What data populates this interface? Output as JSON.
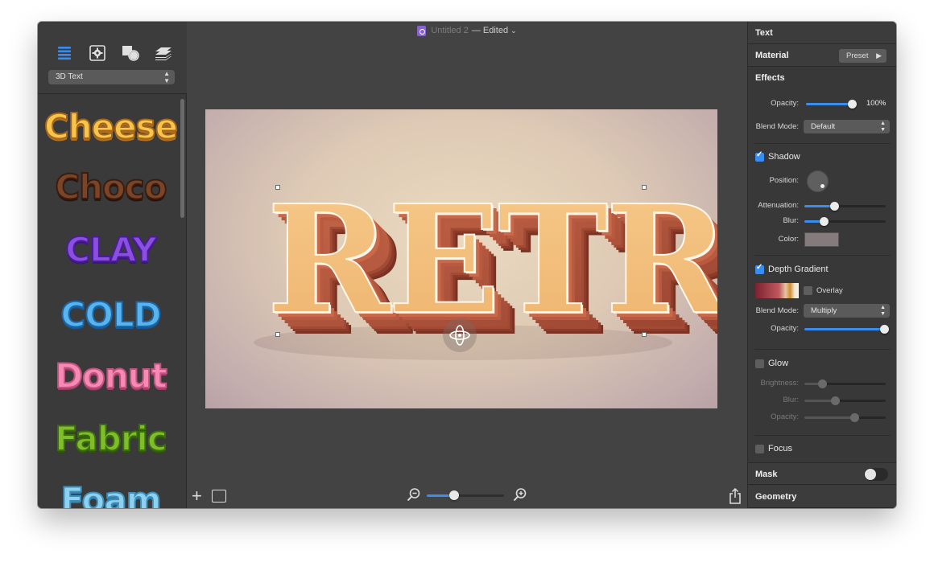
{
  "window": {
    "title_name": "Untitled 2",
    "title_status": "— Edited",
    "title_chevron": "⌄"
  },
  "sidebar": {
    "tabs": [
      {
        "icon": "list-icon"
      },
      {
        "icon": "gear-box-icon"
      },
      {
        "icon": "shapes-icon"
      },
      {
        "icon": "layers-icon"
      }
    ],
    "style_popup": "3D Text",
    "presets": [
      "Cheese",
      "Choco",
      "CLAY",
      "COLD",
      "Donut",
      "Fabric",
      "Foam"
    ]
  },
  "canvas": {
    "text": "RETRO"
  },
  "bottom_bar": {
    "add_label": "+",
    "zoom_value": 0.35
  },
  "inspector": {
    "text_header": "Text",
    "material_header": "Material",
    "preset_label": "Preset",
    "preset_arrow": "▶",
    "effects_header": "Effects",
    "opacity_label": "Opacity:",
    "opacity_value": "100%",
    "opacity_level": 1.0,
    "blend_mode_label": "Blend Mode:",
    "blend_mode_value": "Default",
    "shadow": {
      "label": "Shadow",
      "checked": true,
      "position_label": "Position:",
      "attenuation_label": "Attenuation:",
      "attenuation_level": 0.37,
      "blur_label": "Blur:",
      "blur_level": 0.24,
      "color_label": "Color:",
      "color": "#867b7c"
    },
    "depth_gradient": {
      "label": "Depth Gradient",
      "checked": true,
      "overlay_label": "Overlay",
      "blend_mode_label": "Blend Mode:",
      "blend_mode_value": "Multiply",
      "opacity_label": "Opacity:",
      "opacity_level": 1.0
    },
    "glow": {
      "label": "Glow",
      "checked": false,
      "brightness_label": "Brightness:",
      "brightness_level": 0.22,
      "blur_label": "Blur:",
      "blur_level": 0.38,
      "opacity_label": "Opacity:",
      "opacity_level": 0.61
    },
    "focus": {
      "label": "Focus",
      "checked": false
    },
    "mask_header": "Mask",
    "geometry_header": "Geometry"
  },
  "colors": {
    "accent": "#3a8df0",
    "window_bg": "#434343",
    "panel_bg": "#383838"
  }
}
